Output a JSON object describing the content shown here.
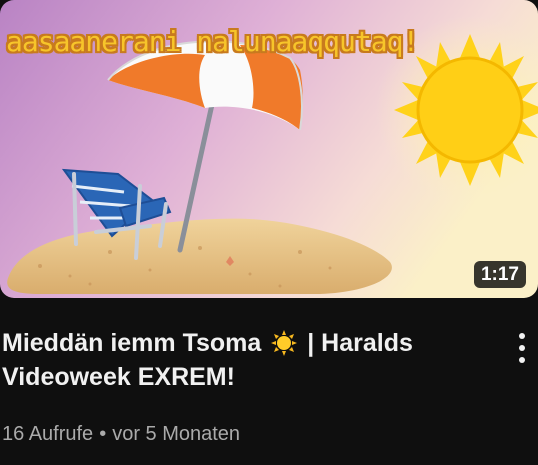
{
  "thumbnail": {
    "overlay_text": "aasaanerani nalunaaqqutaq!",
    "duration": "1:17",
    "colors": {
      "sky_left": "#c48bc8",
      "sky_right": "#f8e6c6",
      "sand": "#e8c489",
      "umbrella_orange": "#f07a2a",
      "umbrella_white": "#fafafa",
      "chair_blue": "#2a66b6",
      "sun": "#ffd21a"
    },
    "icons": [
      "beach-umbrella",
      "beach-chair",
      "sun"
    ]
  },
  "video": {
    "title_line1_before": "Mieddän iemm Tsoma",
    "title_line1_after": "| Haralds",
    "title_line2": "Videoweek EXREM!",
    "views": "16 Aufrufe",
    "separator": "•",
    "age": "vor 5 Monaten"
  },
  "menu": {
    "icon": "more-vert-icon"
  }
}
